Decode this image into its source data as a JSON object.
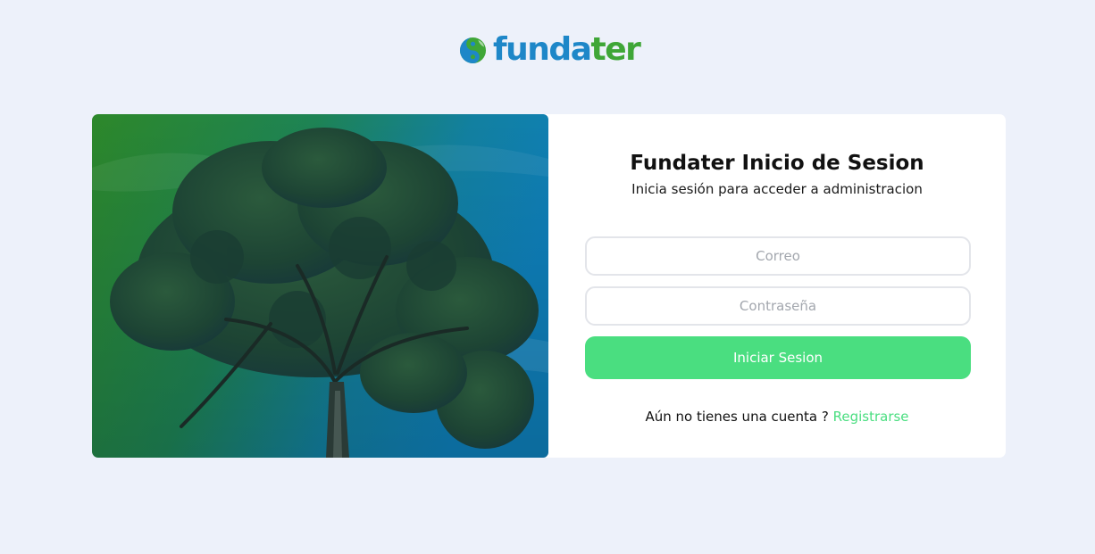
{
  "brand": {
    "name_part1": "funda",
    "name_part2": "ter",
    "logo_icon": "yin-yang-leaf-icon",
    "colors": {
      "blue": "#1e87c8",
      "green": "#3fa637"
    }
  },
  "hero": {
    "image": "tree-photo-green-blue-gradient"
  },
  "login": {
    "title": "Fundater Inicio de Sesion",
    "subtitle": "Inicia sesión para acceder a administracion",
    "email_placeholder": "Correo",
    "password_placeholder": "Contraseña",
    "submit_label": "Iniciar Sesion",
    "register_prompt": "Aún no tienes una cuenta ? ",
    "register_link": "Registrarse"
  },
  "colors": {
    "page_bg": "#edf1fa",
    "accent": "#4ade80",
    "card_bg": "#ffffff"
  }
}
